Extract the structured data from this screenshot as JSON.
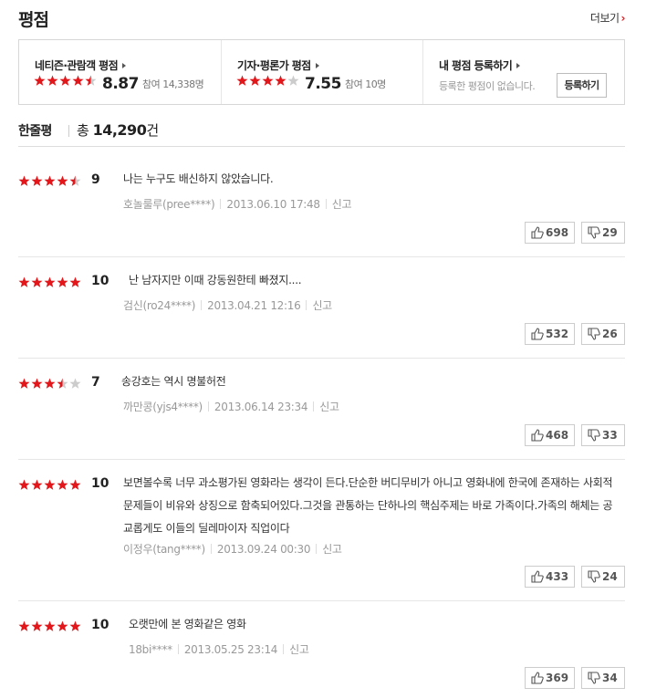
{
  "header": {
    "title": "평점",
    "more_label": "더보기"
  },
  "summary": {
    "netizen": {
      "label": "네티즌·관람객 평점",
      "score": "8.87",
      "participants": "참여 14,338명",
      "stars": 4.5
    },
    "critic": {
      "label": "기자·평론가 평점",
      "score": "7.55",
      "participants": "참여 10명",
      "stars": 4
    },
    "mine": {
      "label": "내 평점 등록하기",
      "desc": "등록한 평점이 없습니다.",
      "button": "등록하기"
    }
  },
  "comments_header": {
    "label": "한줄평",
    "total_prefix": "총 ",
    "total_count": "14,290",
    "total_suffix": "건"
  },
  "reviews": [
    {
      "stars": 4.5,
      "score": "9",
      "text": "나는 누구도 배신하지 않았습니다.",
      "user": "호놀룰루(pree****)",
      "date": "2013.06.10 17:48",
      "report": "신고",
      "likes": "698",
      "dislikes": "29"
    },
    {
      "stars": 5,
      "score": "10",
      "text": "난 남자지만 이때 강동원한테 빠졌지....",
      "user": "검신(ro24****)",
      "date": "2013.04.21 12:16",
      "report": "신고",
      "likes": "532",
      "dislikes": "26"
    },
    {
      "stars": 3.5,
      "score": "7",
      "text": "송강호는 역시 명불허전",
      "user": "까만콩(yjs4****)",
      "date": "2013.06.14 23:34",
      "report": "신고",
      "likes": "468",
      "dislikes": "33"
    },
    {
      "stars": 5,
      "score": "10",
      "text": "보면볼수록 너무 과소평가된 영화라는 생각이 든다.단순한 버디무비가 아니고 영화내에 한국에 존재하는 사회적 문제들이 비유와 상징으로 함축되어있다.그것을 관통하는 단하나의 핵심주제는 바로 가족이다.가족의 해체는 공교롭게도 이들의 딜레마이자 직업이다",
      "user": "이정우(tang****)",
      "date": "2013.09.24 00:30",
      "report": "신고",
      "likes": "433",
      "dislikes": "24"
    },
    {
      "stars": 5,
      "score": "10",
      "text": "오랫만에 본 영화같은 영화",
      "user": "18bi****",
      "date": "2013.05.25 23:14",
      "report": "신고",
      "likes": "369",
      "dislikes": "34"
    }
  ],
  "colors": {
    "star_on": "#e2171b",
    "star_off": "#cccccc",
    "accent": "#e2171b"
  }
}
